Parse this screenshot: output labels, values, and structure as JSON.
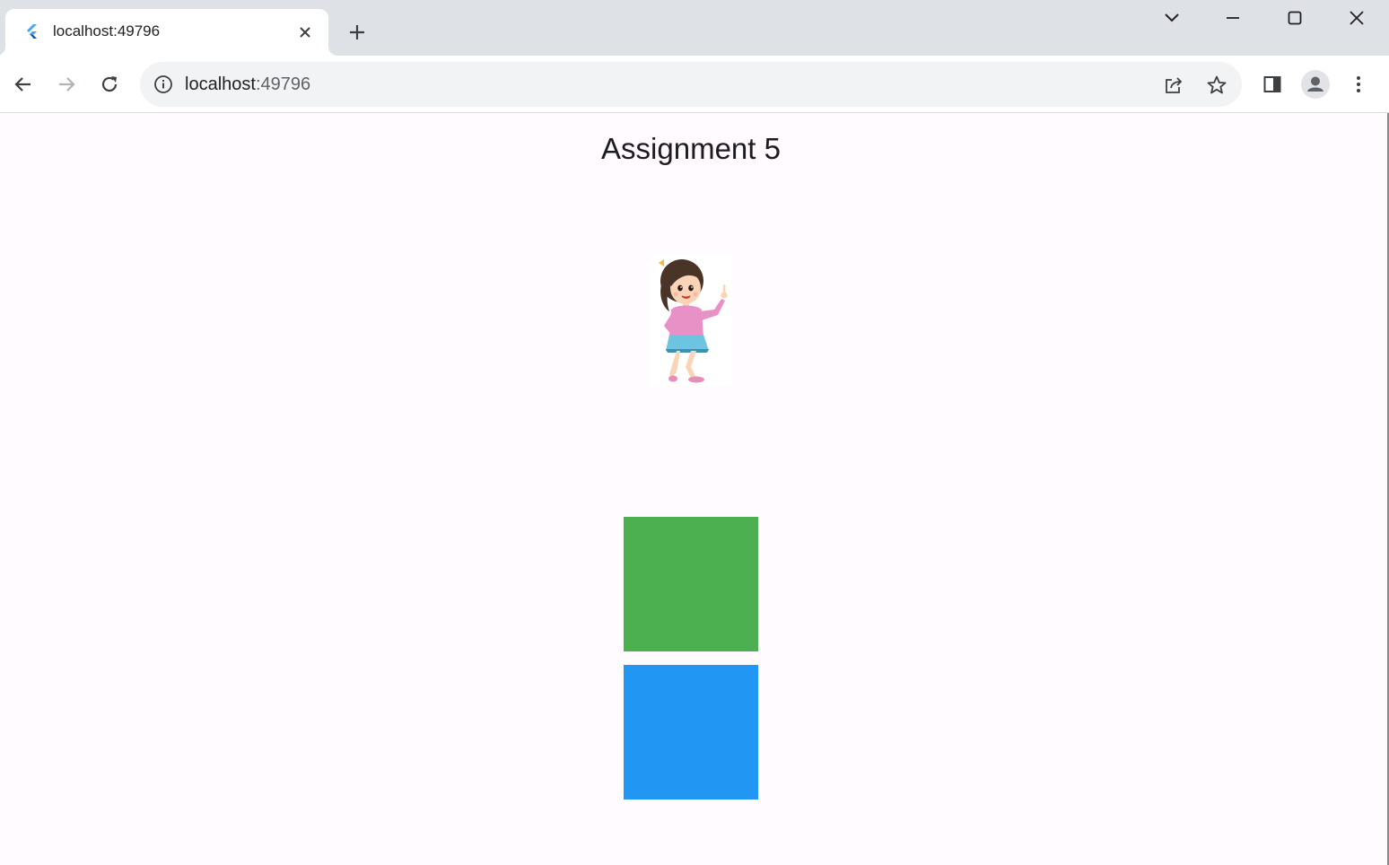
{
  "browser": {
    "tab_title": "localhost:49796",
    "url_host": "localhost",
    "url_port": ":49796"
  },
  "page": {
    "title": "Assignment 5",
    "figure_icon": "cartoon-girl-illustration",
    "boxes": [
      {
        "name": "green-box",
        "color": "#4caf50"
      },
      {
        "name": "blue-box",
        "color": "#2196f3"
      }
    ]
  }
}
